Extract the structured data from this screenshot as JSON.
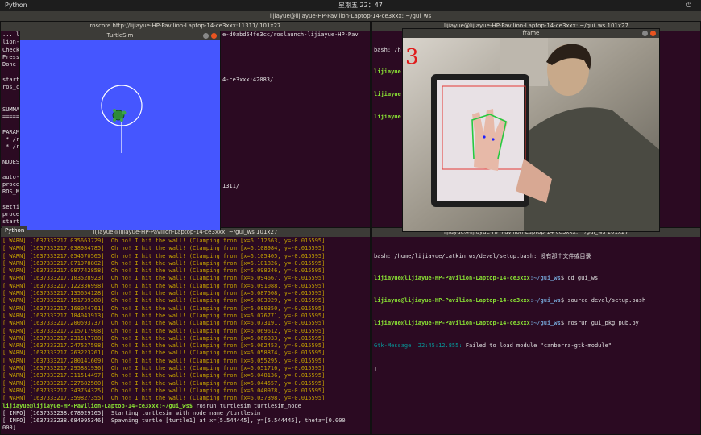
{
  "topbar": {
    "app": "Python",
    "clock": "星期五 22：47"
  },
  "main_title": "lijiayue@lijiayue-HP-Pavilion-Laptop-14-ce3xxx: ~/gui_ws",
  "roscore": {
    "title": "roscore http://lijiayue-HP-Pavilion-Laptop-14-ce3xxx:11311/ 101x27",
    "lines": [
      "... lo",
      "lion-L",
      "Check",
      "Press",
      "Done c",
      "",
      "starte",
      "ros_co",
      "",
      "",
      "SUMMAR",
      "======",
      "",
      "PARAME",
      " * /r",
      " * /r",
      "",
      "NODES",
      "",
      "auto-s",
      "proces",
      "ROS_MA",
      "",
      "settin",
      "proces",
      "starte"
    ],
    "right_frags": [
      "e-d0abd54fe3cc/roslaunch-lijiayue-HP-Pav",
      "4-ce3xxx:42083/",
      "1311/"
    ]
  },
  "turtlesim": {
    "title": "TurtleSim",
    "tooltip": "Python"
  },
  "frame": {
    "title": "frame",
    "overlay_number": "3"
  },
  "term_tr": {
    "title": "lijiayue@lijiayue-HP-Pavilion-Laptop-14-ce3xxx: ~/gui_ws 101x27",
    "lines": [
      "bash: /h",
      "lijiayue",
      "lijiayue",
      "lijiayue"
    ]
  },
  "term_bl": {
    "title": "lijiayue@lijiayue-HP-Pavilion-Laptop-14-ce3xxx: ~/gui_ws 101x27",
    "warns": [
      [
        "1637333217.035663729",
        "6.112563",
        "-0.015595"
      ],
      [
        "1637333217.038984785",
        "6.108984",
        "-0.015595"
      ],
      [
        "1637333217.054570565",
        "6.105405",
        "-0.015595"
      ],
      [
        "1637333217.071978802",
        "6.101826",
        "-0.015595"
      ],
      [
        "1637333217.087742858",
        "6.098246",
        "-0.015595"
      ],
      [
        "1637333217.103528923",
        "6.094667",
        "-0.015595"
      ],
      [
        "1637333217.122336998",
        "6.091088",
        "-0.015595"
      ],
      [
        "1637333217.135654128",
        "6.087508",
        "-0.015595"
      ],
      [
        "1637333217.151739388",
        "6.083929",
        "-0.015595"
      ],
      [
        "1637333217.168044761",
        "6.080350",
        "-0.015595"
      ],
      [
        "1637333217.184043913",
        "6.076771",
        "-0.015595"
      ],
      [
        "1637333217.200593737",
        "6.073191",
        "-0.015595"
      ],
      [
        "1637333217.215717908",
        "6.069612",
        "-0.015595"
      ],
      [
        "1637333217.231517788",
        "6.066033",
        "-0.015595"
      ],
      [
        "1637333217.247527598",
        "6.062453",
        "-0.015595"
      ],
      [
        "1637333217.263223261",
        "6.058874",
        "-0.015595"
      ],
      [
        "1637333217.280141609",
        "6.055295",
        "-0.015595"
      ],
      [
        "1637333217.295881936",
        "6.051716",
        "-0.015595"
      ],
      [
        "1637333217.311514497",
        "6.048136",
        "-0.015595"
      ],
      [
        "1637333217.327682580",
        "6.044557",
        "-0.015595"
      ],
      [
        "1637333217.343754325",
        "6.040978",
        "-0.015595"
      ],
      [
        "1637333217.359827355",
        "6.037398",
        "-0.015595"
      ]
    ],
    "warn_msg": "Oh no! I hit the wall! (Clamping from [x=",
    "prompt": "lijiayue@lijiayue-HP-Pavilion-Laptop-14-ce3xxx:~/gui_ws$",
    "cmd": " rosrun turtlesim turtlesim_node",
    "info1": "[ INFO] [1637333238.678929165]: Starting turtlesim with node name /turtlesim",
    "info2": "[ INFO] [1637333238.684995346]: Spawning turtle [turtle1] at x=[5.544445], y=[5.544445], theta=[0.000",
    "info3": "000]"
  },
  "term_br": {
    "title": "lijiayue@lijiayue-HP-Pavilion-Laptop-14-ce3xxx: ~/gui_ws 101x27",
    "l1": "bash: /home/lijiayue/catkin_ws/devel/setup.bash: 没有那个文件或目录",
    "prompt": "lijiayue@lijiayue-HP-Pavilion-Laptop-14-ce3xxx",
    "path": ":~/gui_ws",
    "c1": "$ cd gui_ws",
    "c2": "$ source devel/setup.bash",
    "c3": "$ rosrun gui_pkg pub.py",
    "gtk_label": "Gtk-Message:",
    "gtk_time": " 22:45:12.855:",
    "gtk_msg": " Failed to load module \"canberra-gtk-module\""
  }
}
